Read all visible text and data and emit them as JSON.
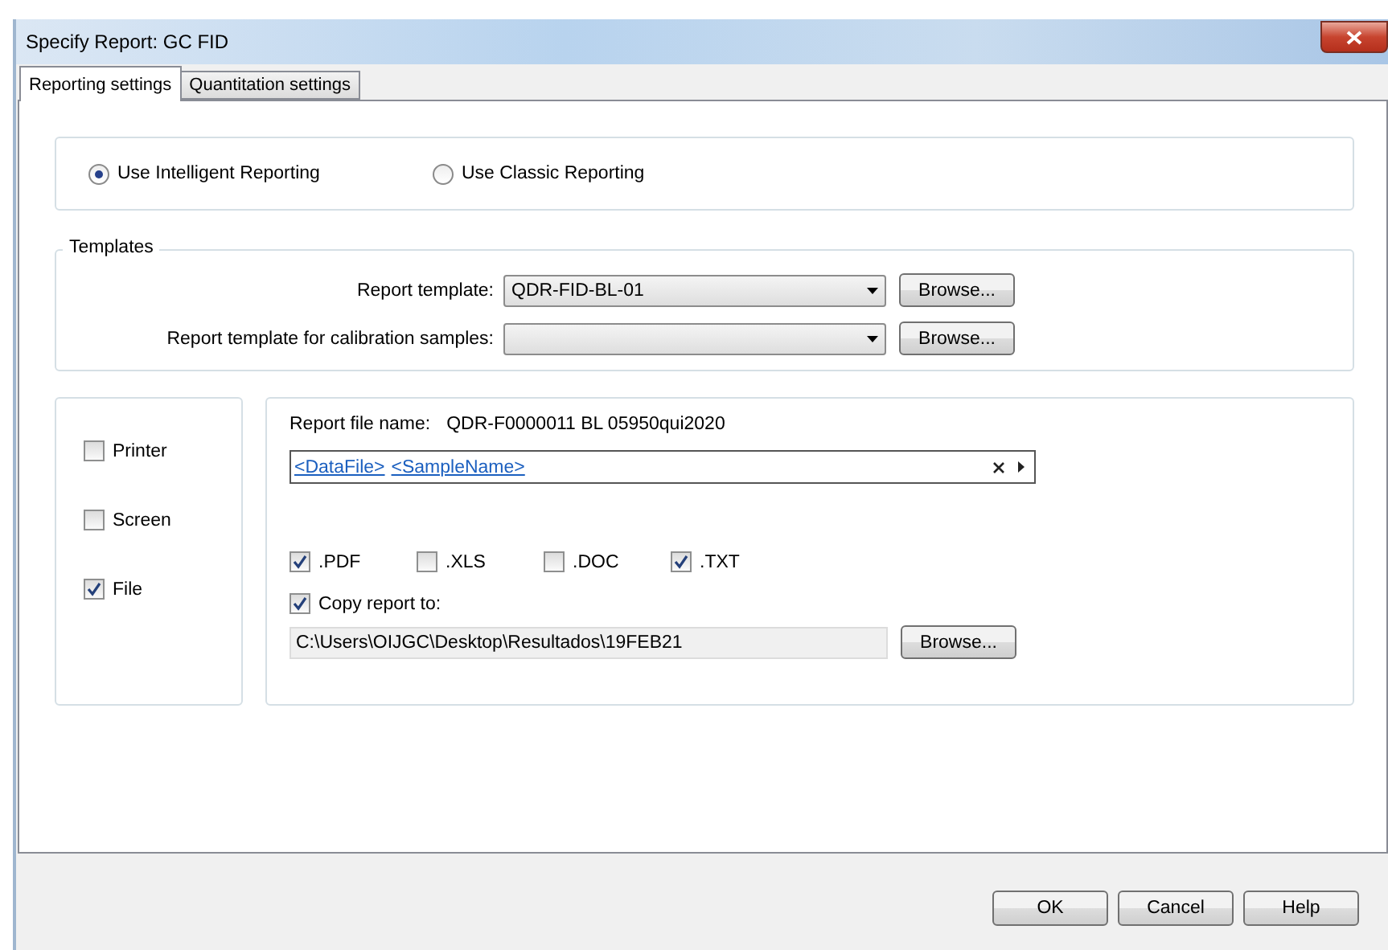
{
  "window": {
    "title": "Specify Report: GC FID"
  },
  "tabs": [
    {
      "label": "Reporting settings",
      "selected": true
    },
    {
      "label": "Quantitation settings",
      "selected": false
    }
  ],
  "reporting_mode": [
    {
      "label": "Use Intelligent Reporting",
      "selected": true
    },
    {
      "label": "Use Classic Reporting",
      "selected": false
    }
  ],
  "templates": {
    "title": "Templates",
    "rows": [
      {
        "label": "Report template:",
        "value": "QDR-FID-BL-01",
        "button": "Browse..."
      },
      {
        "label": "Report template for calibration samples:",
        "button": "Browse..."
      }
    ]
  },
  "destinations": [
    {
      "label": "Printer",
      "checked": false
    },
    {
      "label": "Screen",
      "checked": false
    },
    {
      "label": "File",
      "checked": true
    }
  ],
  "file": {
    "name_label": "Report file name:",
    "name_value": "QDR-F0000011 BL 05950qui2020",
    "tokens": [
      "<DataFile>",
      "<SampleName>"
    ]
  },
  "formats": [
    {
      "label": ".PDF",
      "checked": true
    },
    {
      "label": ".XLS",
      "checked": false
    },
    {
      "label": ".DOC",
      "checked": false
    },
    {
      "label": ".TXT",
      "checked": true
    }
  ],
  "copy": {
    "label": "Copy report to:",
    "checked": true,
    "path": "C:\\Users\\OIJGC\\Desktop\\Resultados\\19FEB21",
    "button": "Browse..."
  },
  "buttons": [
    "OK",
    "Cancel",
    "Help"
  ]
}
